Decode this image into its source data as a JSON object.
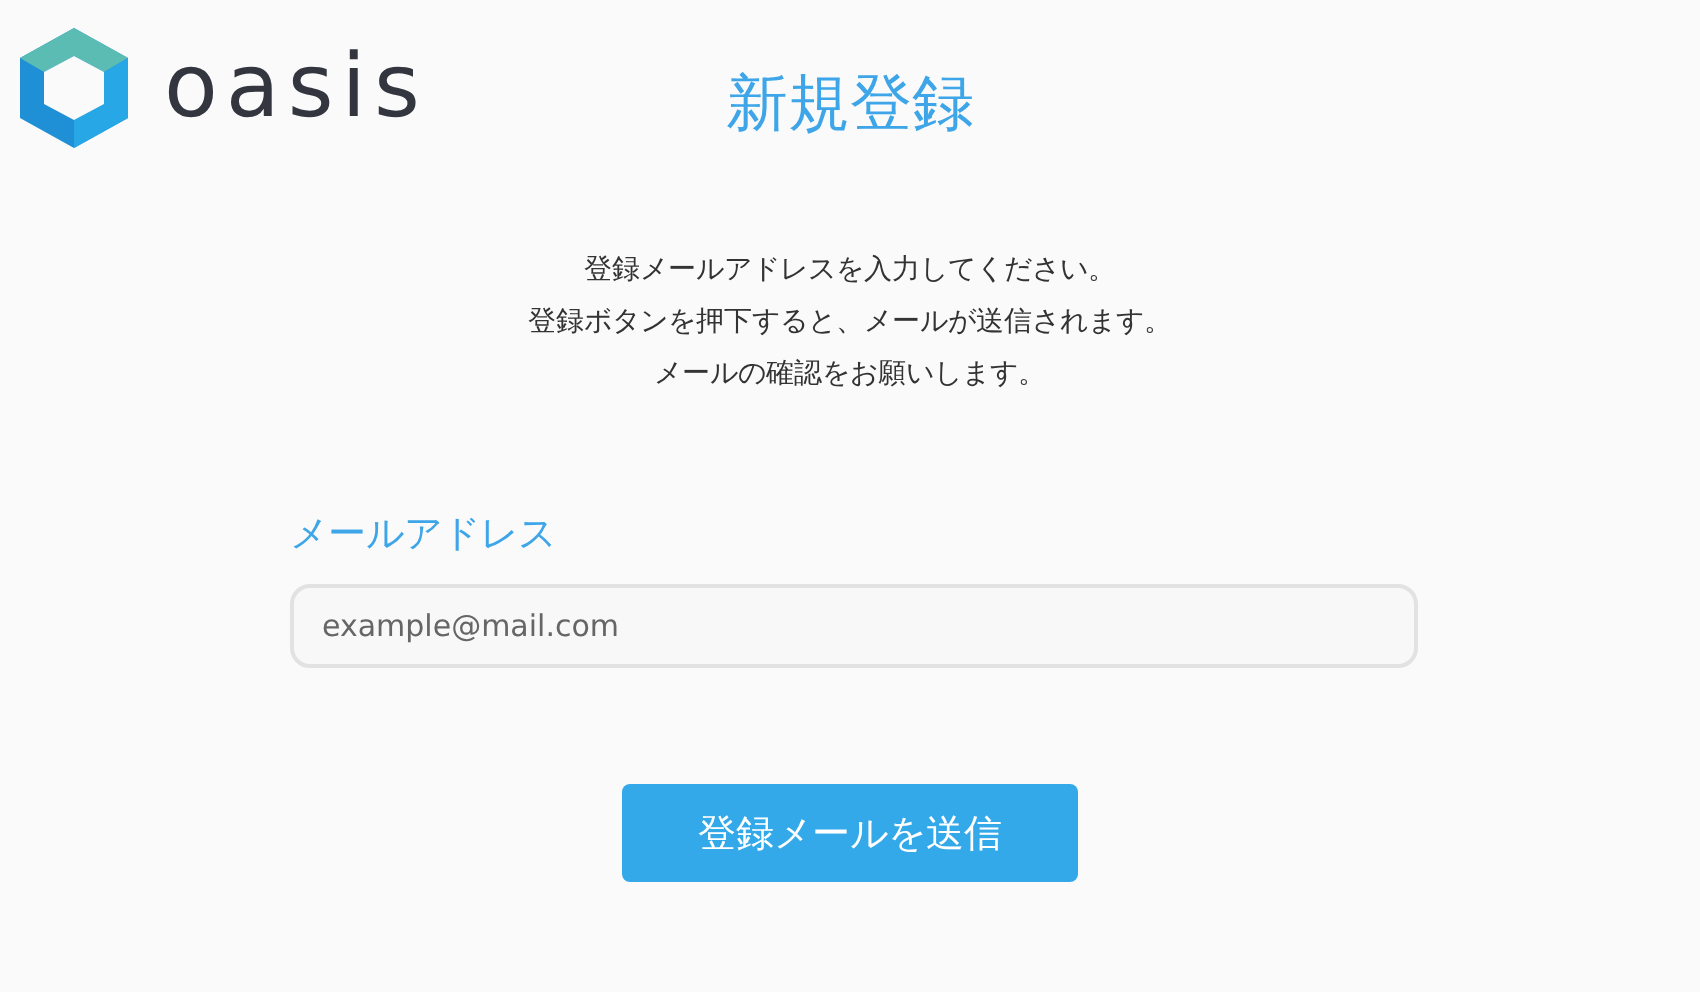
{
  "logo": {
    "text": "oasis"
  },
  "title": "新規登録",
  "instructions": [
    "登録メールアドレスを入力してください。",
    "登録ボタンを押下すると、メールが送信されます。",
    "メールの確認をお願いします。"
  ],
  "email_field": {
    "label": "メールアドレス",
    "placeholder": "example@mail.com"
  },
  "submit_button": "登録メールを送信"
}
